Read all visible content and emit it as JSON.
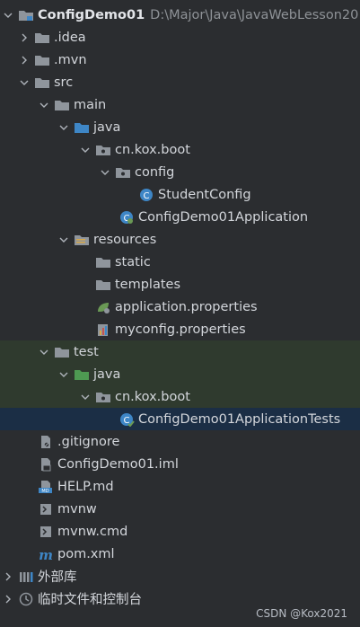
{
  "project_tree": {
    "root": {
      "label": "ConfigDemo01",
      "path": "D:\\Major\\Java\\JavaWebLesson20"
    },
    "items": [
      {
        "label": ".idea"
      },
      {
        "label": ".mvn"
      },
      {
        "label": "src"
      },
      {
        "label": "main"
      },
      {
        "label": "java"
      },
      {
        "label": "cn.kox.boot"
      },
      {
        "label": "config"
      },
      {
        "label": "StudentConfig"
      },
      {
        "label": "ConfigDemo01Application"
      },
      {
        "label": "resources"
      },
      {
        "label": "static"
      },
      {
        "label": "templates"
      },
      {
        "label": "application.properties"
      },
      {
        "label": "myconfig.properties"
      },
      {
        "label": "test"
      },
      {
        "label": "java"
      },
      {
        "label": "cn.kox.boot"
      },
      {
        "label": "ConfigDemo01ApplicationTests"
      },
      {
        "label": ".gitignore"
      },
      {
        "label": "ConfigDemo01.iml"
      },
      {
        "label": "HELP.md"
      },
      {
        "label": "mvnw"
      },
      {
        "label": "mvnw.cmd"
      },
      {
        "label": "pom.xml"
      },
      {
        "label": "外部库"
      },
      {
        "label": "临时文件和控制台"
      }
    ]
  },
  "watermark": "CSDN @Kox2021",
  "colors": {
    "background": "#2b2d30",
    "selected_row": "#1b2e45",
    "test_root_row": "#2f3a2e",
    "folder": "#8f959c",
    "source_folder": "#3e86c6",
    "test_folder": "#4e9a52",
    "class_icon": "#3e86c6"
  }
}
